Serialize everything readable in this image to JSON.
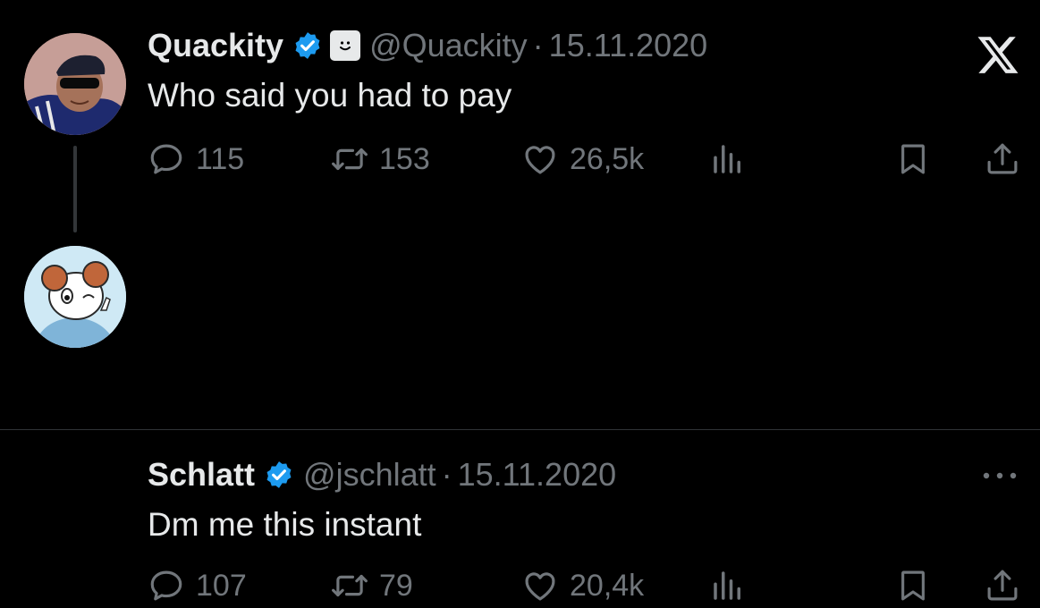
{
  "colors": {
    "background": "#000000",
    "text": "#e7e9ea",
    "muted": "#71767b",
    "verified": "#1d9bf0"
  },
  "tweets": [
    {
      "name": "Quackity",
      "handle": "@Quackity",
      "separator": "·",
      "date": "15.11.2020",
      "text": "Who said you had to pay",
      "replies": "115",
      "retweets": "153",
      "likes": "26,5k",
      "icons": [
        "verified-badge-icon",
        "affiliate-badge-icon",
        "x-logo-icon"
      ]
    },
    {
      "name": "Schlatt",
      "handle": "@jschlatt",
      "separator": "·",
      "date": "15.11.2020",
      "text": "Dm me this instant",
      "replies": "107",
      "retweets": "79",
      "likes": "20,4k",
      "icons": [
        "verified-badge-icon",
        "more-options-icon"
      ]
    }
  ],
  "action_icons": [
    "reply-icon",
    "retweet-icon",
    "like-icon",
    "views-icon",
    "bookmark-icon",
    "share-icon"
  ]
}
